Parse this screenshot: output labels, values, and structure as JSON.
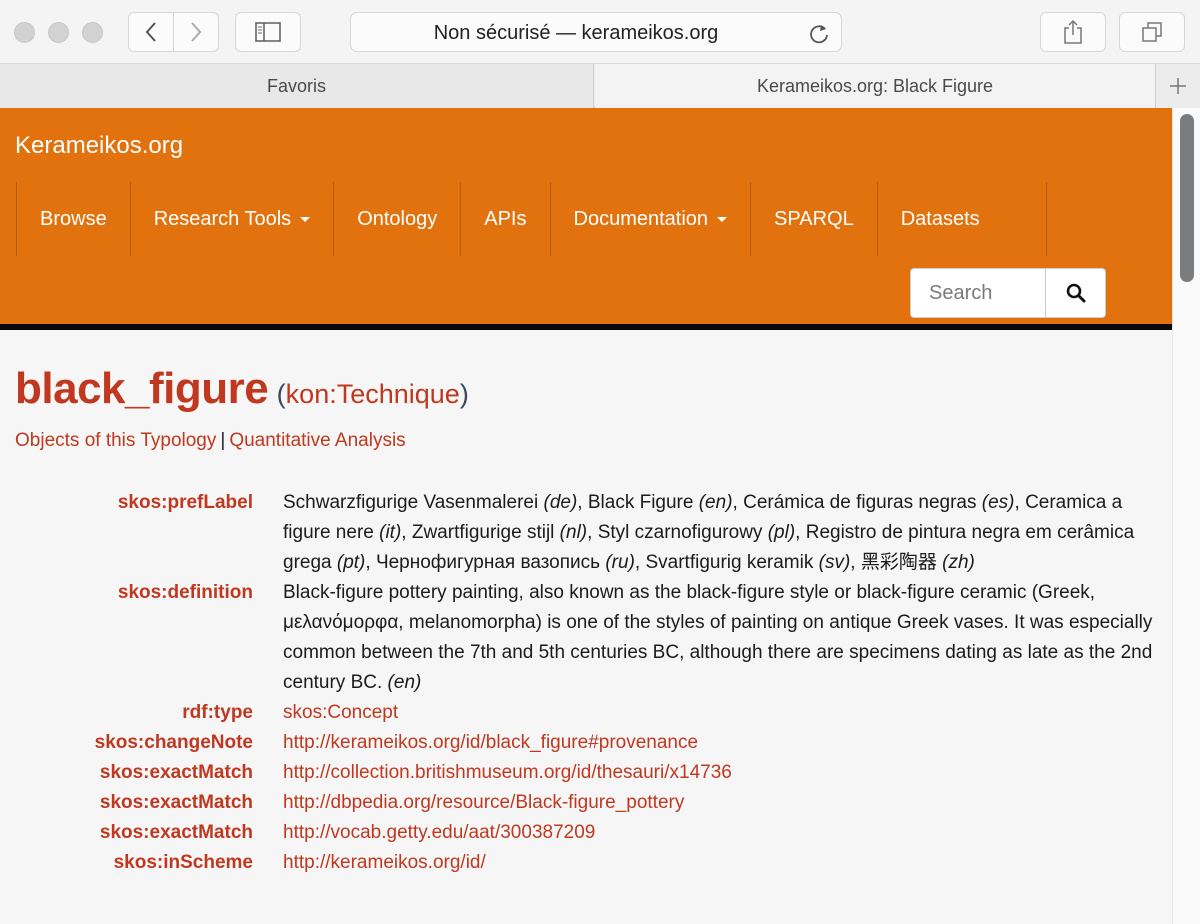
{
  "browser": {
    "url_display": "Non sécurisé — kerameikos.org",
    "tabs": [
      {
        "label": "Favoris",
        "active": false
      },
      {
        "label": "Kerameikos.org: Black Figure",
        "active": true
      }
    ]
  },
  "site": {
    "brand": "Kerameikos.org",
    "accent_color": "#e2720d",
    "link_color": "#c0381f",
    "nav": [
      {
        "label": "Browse",
        "dropdown": false
      },
      {
        "label": "Research Tools",
        "dropdown": true
      },
      {
        "label": "Ontology",
        "dropdown": false
      },
      {
        "label": "APIs",
        "dropdown": false
      },
      {
        "label": "Documentation",
        "dropdown": true
      },
      {
        "label": "SPARQL",
        "dropdown": false
      },
      {
        "label": "Datasets",
        "dropdown": false
      }
    ],
    "search": {
      "placeholder": "Search",
      "value": ""
    }
  },
  "page": {
    "title": "black_figure",
    "type_open": "(",
    "type": "kon:Technique",
    "type_close": ")",
    "links": {
      "objects": "Objects of this Typology",
      "separator": "|",
      "analysis": "Quantitative Analysis"
    },
    "pref_label": {
      "key": "skos:prefLabel",
      "values": [
        {
          "text": "Schwarzfigurige Vasenmalerei",
          "lang": "de"
        },
        {
          "text": "Black Figure",
          "lang": "en"
        },
        {
          "text": "Cerámica de figuras negras",
          "lang": "es"
        },
        {
          "text": "Ceramica a figure nere",
          "lang": "it"
        },
        {
          "text": "Zwartfigurige stijl",
          "lang": "nl"
        },
        {
          "text": "Styl czarnofigurowy",
          "lang": "pl"
        },
        {
          "text": "Registro de pintura negra em cerâmica grega",
          "lang": "pt"
        },
        {
          "text": "Чернофигурная вазопись",
          "lang": "ru"
        },
        {
          "text": "Svartfigurig keramik",
          "lang": "sv"
        },
        {
          "text": "黑彩陶器",
          "lang": "zh"
        }
      ]
    },
    "definition": {
      "key": "skos:definition",
      "text": "Black-figure pottery painting, also known as the black-figure style or black-figure ceramic (Greek, μελανόμορφα, melanomorpha) is one of the styles of painting on antique Greek vases. It was especially common between the 7th and 5th centuries BC, although there are specimens dating as late as the 2nd century BC.",
      "lang": "en"
    },
    "links_props": [
      {
        "key": "rdf:type",
        "value": "skos:Concept"
      },
      {
        "key": "skos:changeNote",
        "value": "http://kerameikos.org/id/black_figure#provenance"
      },
      {
        "key": "skos:exactMatch",
        "value": "http://collection.britishmuseum.org/id/thesauri/x14736"
      },
      {
        "key": "skos:exactMatch",
        "value": "http://dbpedia.org/resource/Black-figure_pottery"
      },
      {
        "key": "skos:exactMatch",
        "value": "http://vocab.getty.edu/aat/300387209"
      },
      {
        "key": "skos:inScheme",
        "value": "http://kerameikos.org/id/"
      }
    ]
  }
}
